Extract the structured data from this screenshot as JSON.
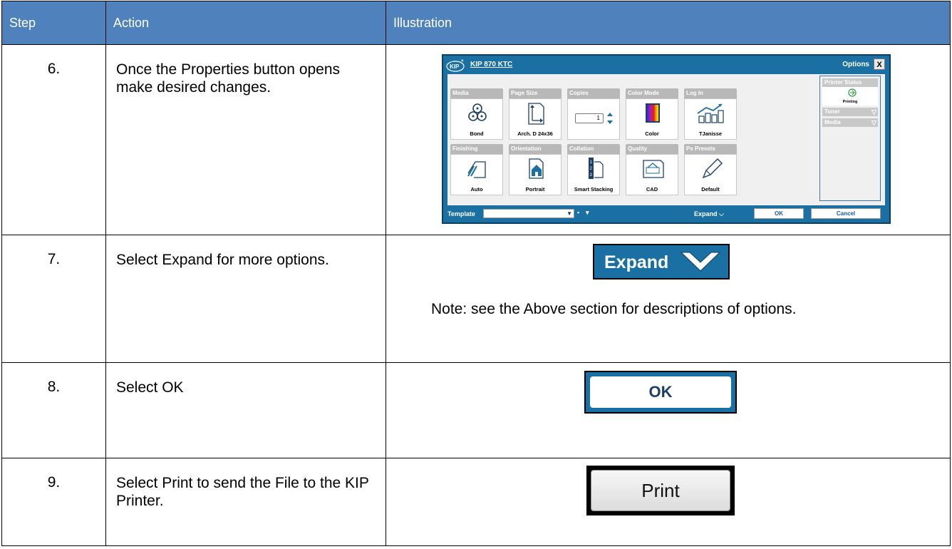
{
  "table": {
    "headers": [
      "Step",
      "Action",
      "Illustration"
    ],
    "rows": [
      {
        "step": "6.",
        "action": "Once the Properties button opens make desired changes."
      },
      {
        "step": "7.",
        "action": "Select Expand for more options."
      },
      {
        "step": "8.",
        "action": "Select OK"
      },
      {
        "step": "9.",
        "action": "Select Print to send the File to the KIP Printer."
      }
    ]
  },
  "kip_dialog": {
    "logo": "KIP",
    "title": "KIP 870 KTC",
    "options_label": "Options",
    "close_label": "X",
    "tiles": [
      {
        "head": "Media",
        "value": "Bond",
        "icon": "media-rolls-icon"
      },
      {
        "head": "Page Size",
        "value": "Arch. D 24x36",
        "icon": "page-size-icon"
      },
      {
        "head": "Copies",
        "value": "1",
        "icon": "copies-stepper-icon"
      },
      {
        "head": "Color Mode",
        "value": "Color",
        "icon": "color-mode-icon"
      },
      {
        "head": "Log In",
        "value": "TJanisse",
        "icon": "login-chart-icon"
      },
      {
        "head": "Finishing",
        "value": "Auto",
        "icon": "finishing-icon"
      },
      {
        "head": "Orientation",
        "value": "Portrait",
        "icon": "house-icon"
      },
      {
        "head": "Collation",
        "value": "Smart Stacking",
        "icon": "collation-icon"
      },
      {
        "head": "Quality",
        "value": "CAD",
        "icon": "quality-icon"
      },
      {
        "head": "Ps Presets",
        "value": "Default",
        "icon": "pen-icon"
      }
    ],
    "printer_status": {
      "head": "Printer Status",
      "state": "Printing",
      "toner": "Toner",
      "media": "Media"
    },
    "footer": {
      "template_label": "Template",
      "expand_label": "Expand",
      "ok_label": "OK",
      "cancel_label": "Cancel"
    }
  },
  "expand_button": {
    "label": "Expand"
  },
  "note": "Note: see the Above section for descriptions of options.",
  "ok_button": {
    "label": "OK"
  },
  "print_button": {
    "label": "Print"
  },
  "colors": {
    "header_bg": "#4f81bd",
    "kip_blue": "#1a6fa3"
  }
}
